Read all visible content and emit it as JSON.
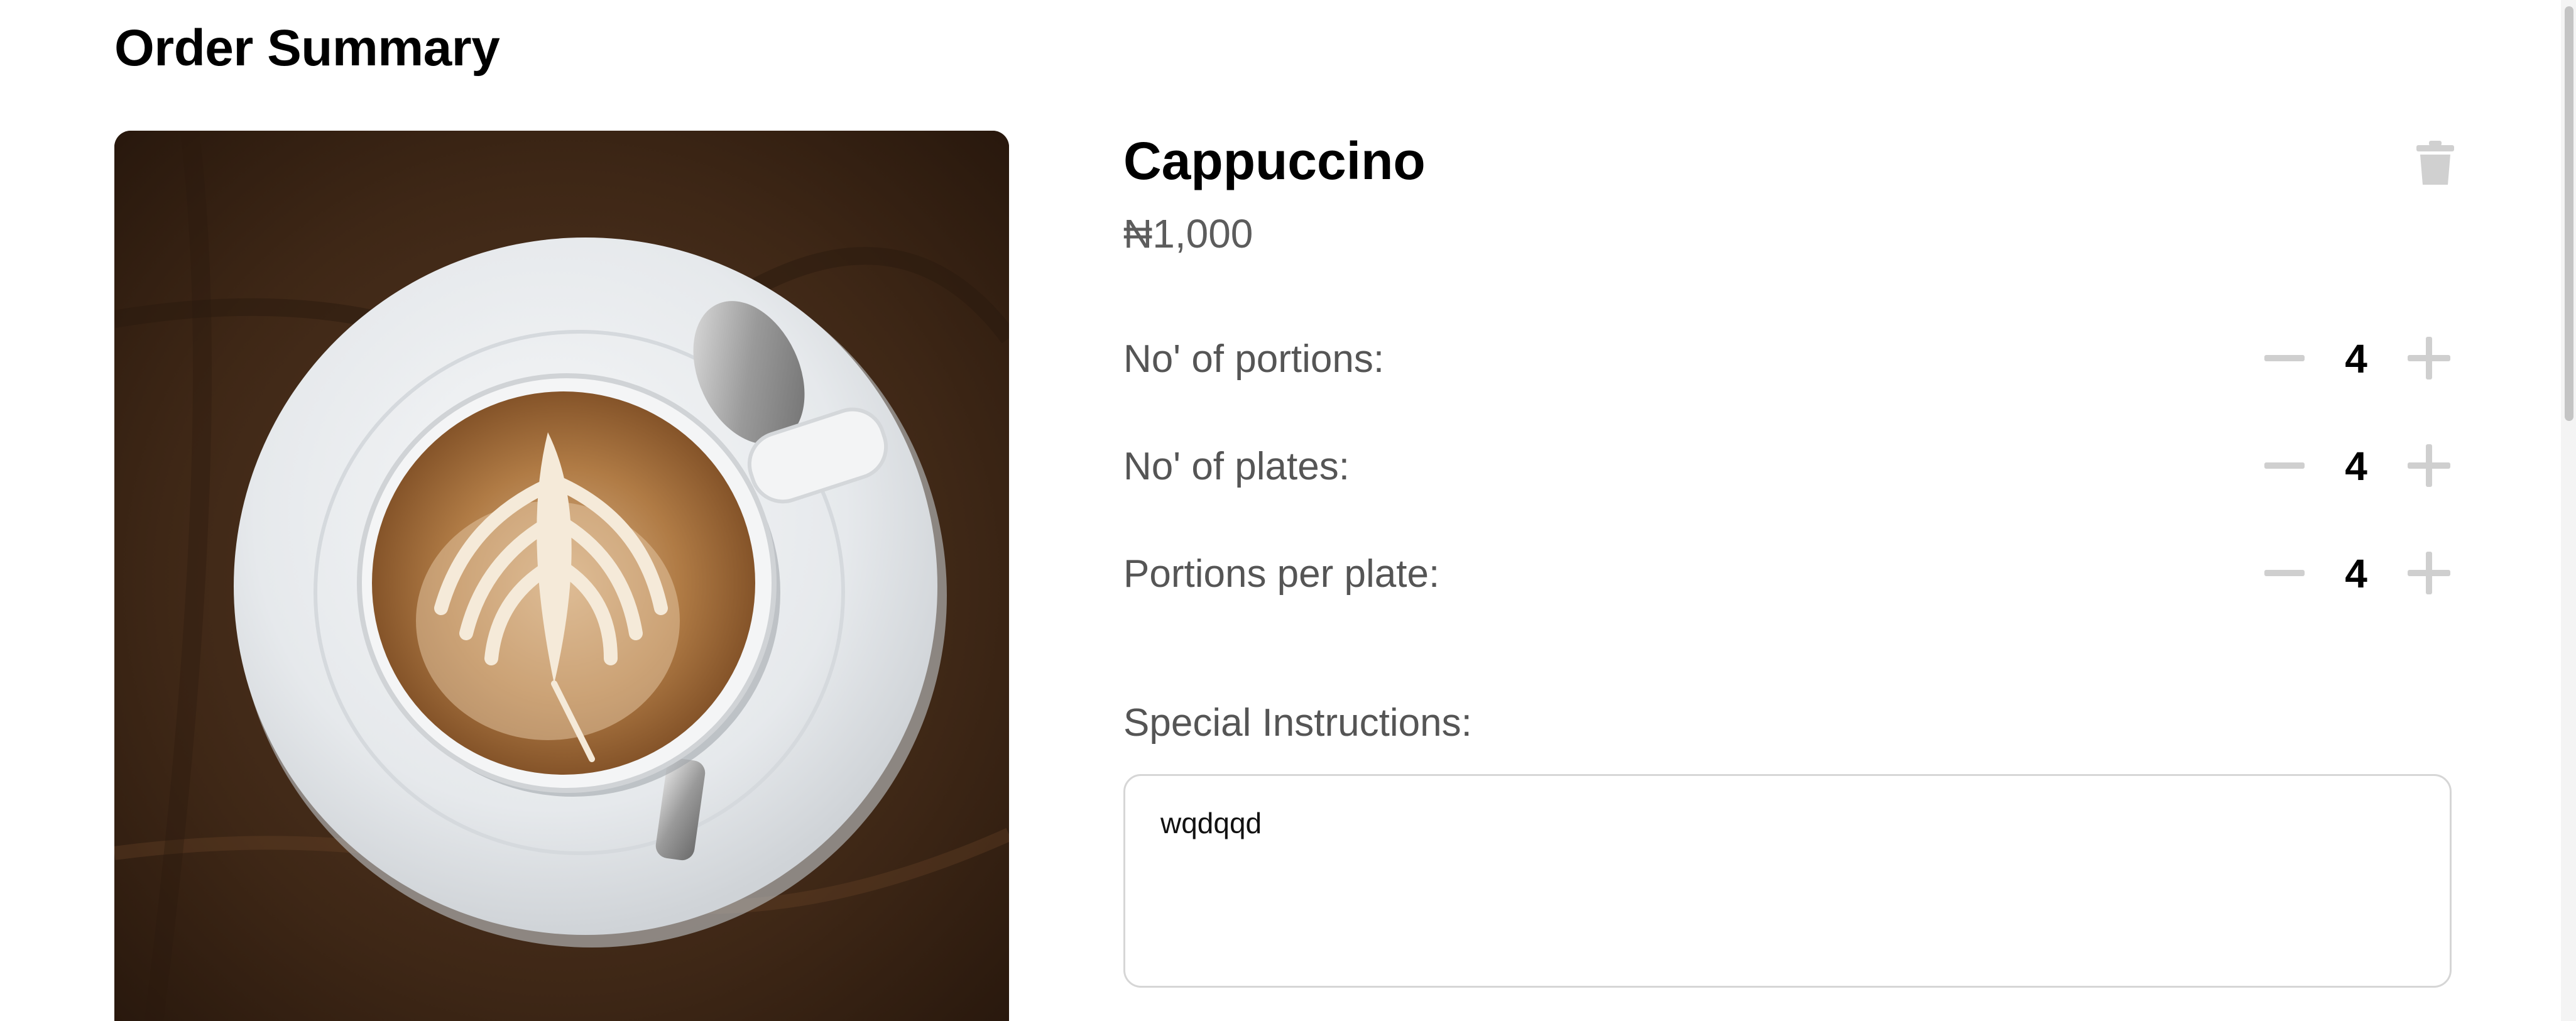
{
  "page": {
    "title": "Order Summary"
  },
  "item": {
    "name": "Cappuccino",
    "price": "₦1,000",
    "image_alt_icon": "cappuccino-photo"
  },
  "quantities": [
    {
      "label": "No' of portions:",
      "value": "4"
    },
    {
      "label": "No' of plates:",
      "value": "4"
    },
    {
      "label": "Portions per plate:",
      "value": "4"
    }
  ],
  "special_instructions": {
    "label": "Special Instructions:",
    "value": "wqdqqd"
  },
  "icons": {
    "delete": "trash-icon",
    "decrement": "minus-icon",
    "increment": "plus-icon"
  },
  "colors": {
    "text_primary": "#000000",
    "text_secondary": "#555555",
    "icon_muted": "#cfcfcf",
    "border": "#d6d6d6"
  }
}
